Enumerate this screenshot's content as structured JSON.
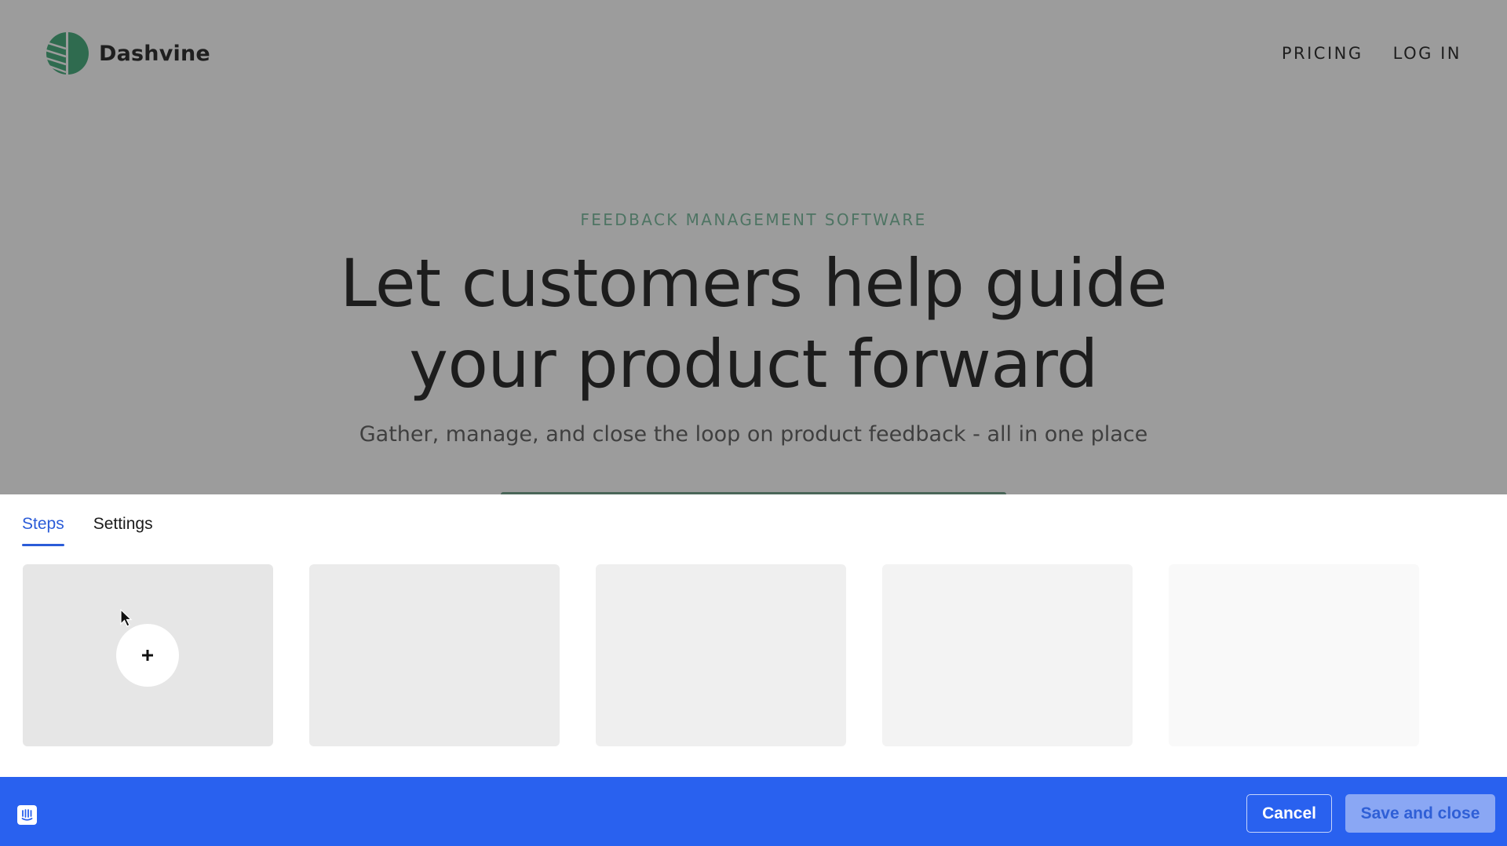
{
  "site": {
    "brand": {
      "name": "Dashvine",
      "logo_icon": "leaf-circle-logo",
      "logo_color": "#2f6b4f"
    },
    "nav": [
      {
        "label": "PRICING"
      },
      {
        "label": "LOG IN"
      }
    ],
    "hero": {
      "eyebrow": "FEEDBACK MANAGEMENT SOFTWARE",
      "headline_line1": "Let customers help guide",
      "headline_line2": "your product forward",
      "subhead": "Gather, manage, and close the loop on product feedback - all in one place"
    }
  },
  "builder": {
    "tabs": [
      {
        "label": "Steps",
        "active": true
      },
      {
        "label": "Settings",
        "active": false
      }
    ],
    "steps": [
      {
        "type": "add-step",
        "icon": "plus-icon"
      },
      {
        "type": "placeholder"
      },
      {
        "type": "placeholder"
      },
      {
        "type": "placeholder"
      },
      {
        "type": "placeholder"
      }
    ],
    "footer": {
      "logo_icon": "intercom-icon",
      "cancel_label": "Cancel",
      "save_label": "Save and close",
      "accent_color": "#2961ef"
    }
  }
}
